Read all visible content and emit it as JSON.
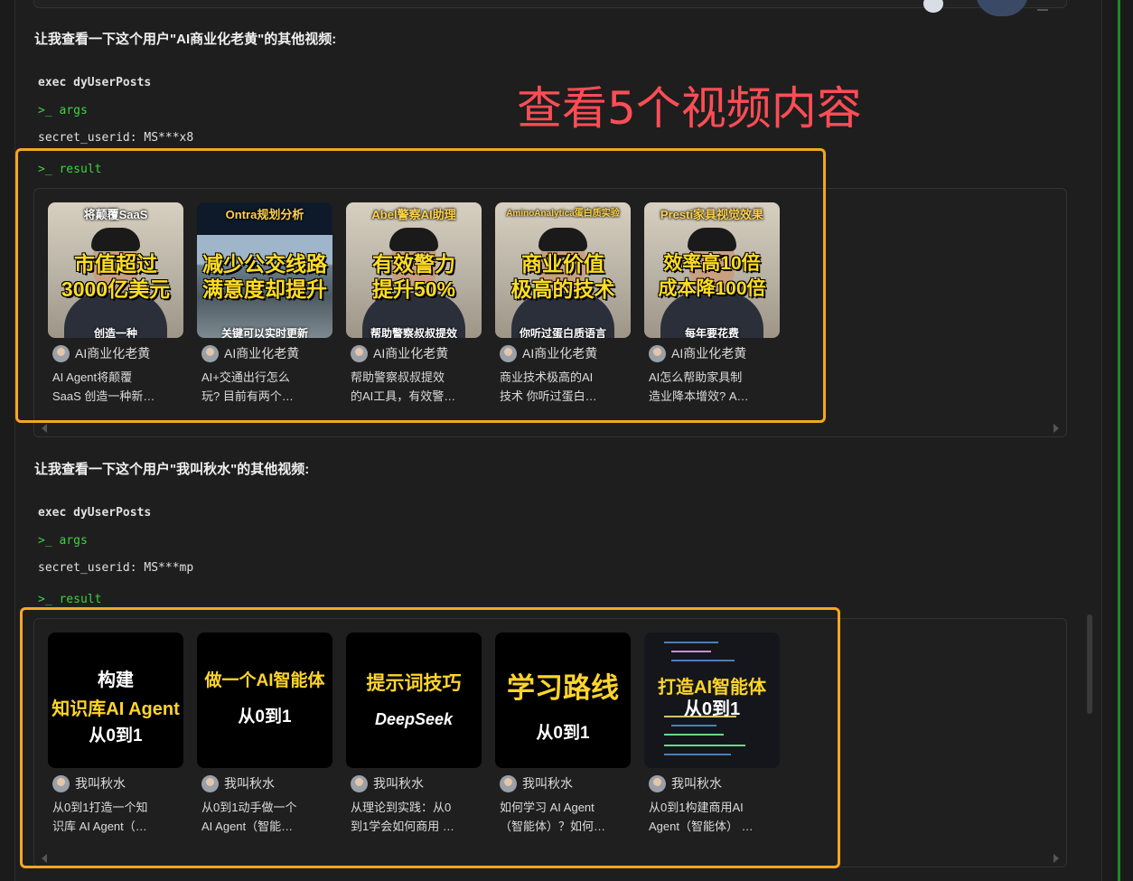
{
  "annotation": "查看5个视频内容",
  "colors": {
    "highlight": "#f5a623",
    "annotation": "#ff4d55",
    "prompt": "#3fd23f"
  },
  "sections": [
    {
      "intro": "让我查看一下这个用户\"AI商业化老黄\"的其他视频:",
      "exec_label": "exec dyUserPosts",
      "args_label": ">_ args",
      "param": "secret_userid: MS***x8",
      "result_label": ">_ result",
      "videos": [
        {
          "thumb_top": "将颠覆SaaS",
          "thumb_main": "市值超过\n3000亿美元",
          "thumb_bottom": "创造一种",
          "author": "AI商业化老黄",
          "desc_line1": "AI Agent将颠覆",
          "desc_line2": "SaaS 创造一种新…"
        },
        {
          "thumb_top": "Ontra规划分析",
          "thumb_main": "减少公交线路\n满意度却提升",
          "thumb_bottom": "关键可以实时更新",
          "author": "AI商业化老黄",
          "desc_line1": "AI+交通出行怎么",
          "desc_line2": "玩? 目前有两个…"
        },
        {
          "thumb_top": "Abel警察AI助理",
          "thumb_main": "有效警力\n提升50%",
          "thumb_bottom": "帮助警察叔叔提效",
          "author": "AI商业化老黄",
          "desc_line1": "帮助警察叔叔提效",
          "desc_line2": "的AI工具，有效警…"
        },
        {
          "thumb_top": "AminoAnalytica蛋白质实验",
          "thumb_main": "商业价值\n极高的技术",
          "thumb_bottom": "你听过蛋白质语言",
          "author": "AI商业化老黄",
          "desc_line1": "商业技术极高的AI",
          "desc_line2": "技术 你听过蛋白…"
        },
        {
          "thumb_top": "Presti家具视觉效果",
          "thumb_main": "效率高10倍\n成本降100倍",
          "thumb_bottom": "每年要花费",
          "author": "AI商业化老黄",
          "desc_line1": "AI怎么帮助家具制",
          "desc_line2": "造业降本增效? A…"
        }
      ]
    },
    {
      "intro": "让我查看一下这个用户\"我叫秋水\"的其他视频:",
      "exec_label": "exec dyUserPosts",
      "args_label": ">_ args",
      "param": "secret_userid: MS***mp",
      "result_label": ">_ result",
      "videos": [
        {
          "thumb_l1": "构建",
          "thumb_l2": "知识库AI Agent",
          "thumb_l3": "从0到1",
          "author": "我叫秋水",
          "desc_line1": "从0到1打造一个知",
          "desc_line2": "识库 AI Agent（…"
        },
        {
          "thumb_l1": "做一个AI智能体",
          "thumb_l2": "从0到1",
          "thumb_l3": "",
          "author": "我叫秋水",
          "desc_line1": "从0到1动手做一个",
          "desc_line2": "AI Agent（智能…"
        },
        {
          "thumb_l1": "提示词技巧",
          "thumb_l2": "DeepSeek",
          "thumb_l3": "",
          "author": "我叫秋水",
          "desc_line1": "从理论到实践：从0",
          "desc_line2": "到1学会如何商用 …"
        },
        {
          "thumb_l1": "学习路线",
          "thumb_l2": "从0到1",
          "thumb_l3": "",
          "author": "我叫秋水",
          "desc_line1": "如何学习 AI Agent",
          "desc_line2": "（智能体）？如何…"
        },
        {
          "thumb_l1": "打造AI智能体",
          "thumb_l2": "从0到1",
          "thumb_l3": "",
          "author": "我叫秋水",
          "desc_line1": "从0到1构建商用AI",
          "desc_line2": "Agent（智能体） …"
        }
      ]
    }
  ]
}
